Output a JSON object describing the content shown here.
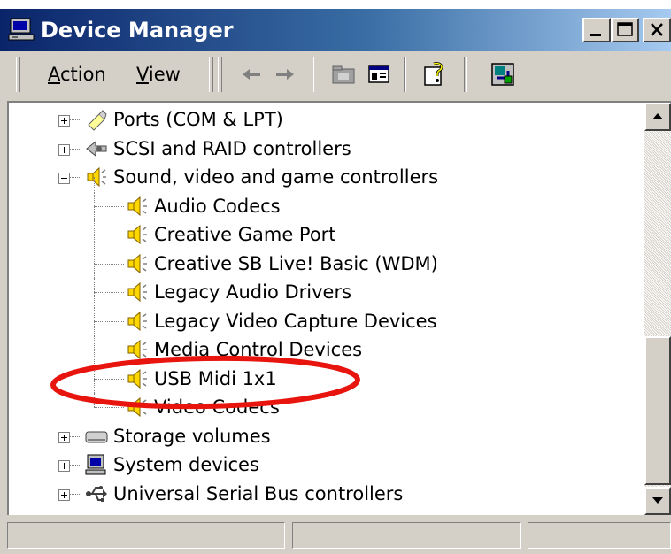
{
  "window": {
    "title": "Device Manager",
    "title_icon": "computer-icon",
    "caption_buttons": [
      "minimize",
      "maximize",
      "close"
    ]
  },
  "toolbar": {
    "menu": [
      {
        "label": "Action",
        "accesskey": "A"
      },
      {
        "label": "View",
        "accesskey": "V"
      }
    ],
    "buttons": [
      "back-arrow-icon",
      "forward-arrow-icon",
      "folder-up-icon",
      "properties-icon",
      "help-icon",
      "update-driver-icon"
    ]
  },
  "tree": {
    "rows": [
      {
        "label": "Ports (COM & LPT)",
        "icon": "port-icon",
        "expander": "plus",
        "level": 0
      },
      {
        "label": "SCSI and RAID controllers",
        "icon": "scsi-icon",
        "expander": "plus",
        "level": 0
      },
      {
        "label": "Sound, video and game controllers",
        "icon": "speaker-icon",
        "expander": "minus",
        "level": 0
      },
      {
        "label": "Audio Codecs",
        "icon": "speaker-icon",
        "expander": "none",
        "level": 1
      },
      {
        "label": "Creative Game Port",
        "icon": "speaker-icon",
        "expander": "none",
        "level": 1
      },
      {
        "label": "Creative SB Live! Basic (WDM)",
        "icon": "speaker-icon",
        "expander": "none",
        "level": 1
      },
      {
        "label": "Legacy Audio Drivers",
        "icon": "speaker-icon",
        "expander": "none",
        "level": 1
      },
      {
        "label": "Legacy Video Capture Devices",
        "icon": "speaker-icon",
        "expander": "none",
        "level": 1
      },
      {
        "label": "Media Control Devices",
        "icon": "speaker-icon",
        "expander": "none",
        "level": 1
      },
      {
        "label": "USB Midi 1x1",
        "icon": "speaker-icon",
        "expander": "none",
        "level": 1,
        "highlighted": true
      },
      {
        "label": "Video Codecs",
        "icon": "speaker-icon",
        "expander": "none",
        "level": 1
      },
      {
        "label": "Storage volumes",
        "icon": "drive-icon",
        "expander": "plus",
        "level": 0
      },
      {
        "label": "System devices",
        "icon": "system-icon",
        "expander": "plus",
        "level": 0
      },
      {
        "label": "Universal Serial Bus controllers",
        "icon": "usb-icon",
        "expander": "plus",
        "level": 0
      }
    ]
  },
  "colors": {
    "title_gradient_start": "#0a246a",
    "title_gradient_end": "#a6caf0",
    "chrome": "#d4d0c8",
    "annotation": "#e8140e"
  },
  "statusbar": {
    "panes": [
      "",
      "",
      ""
    ]
  }
}
